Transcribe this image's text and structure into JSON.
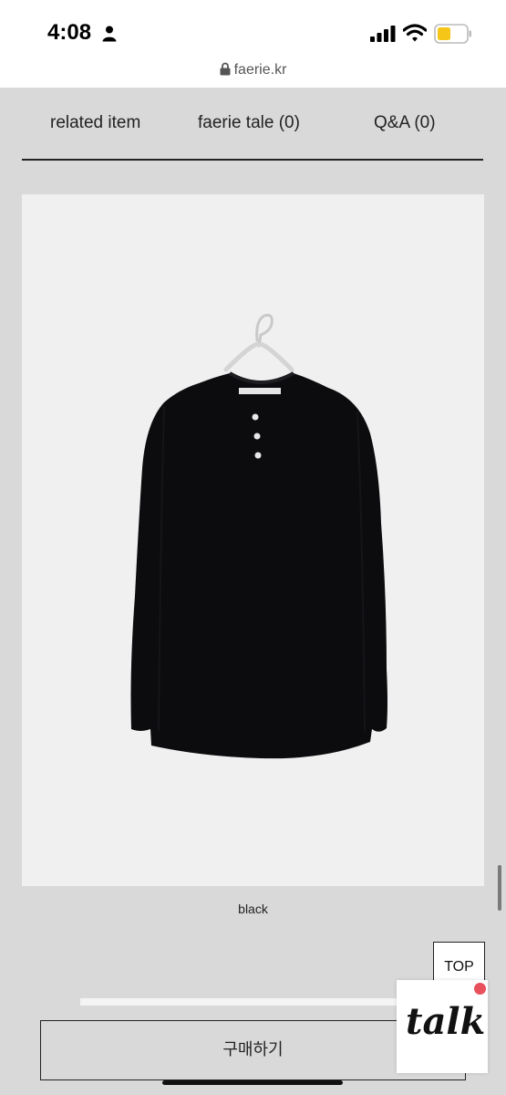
{
  "status_bar": {
    "time": "4:08",
    "icons": [
      "person-icon",
      "signal-icon",
      "wifi-icon",
      "battery-icon"
    ],
    "battery_color": "#f5c518"
  },
  "url_bar": {
    "url": "faerie.kr",
    "icon": "lock-icon"
  },
  "tabs": [
    {
      "label": "related item"
    },
    {
      "label": "faerie tale (0)"
    },
    {
      "label": "Q&A (0)"
    }
  ],
  "product": {
    "image_icon": "shirt-on-hanger",
    "caption": "black",
    "garment_color": "#0c0c0f",
    "background_color": "#f0f0f0"
  },
  "top_button": {
    "label": "TOP"
  },
  "bottom_bar": {
    "buy_label": "구매하기"
  },
  "talk_widget": {
    "label": "talk",
    "dot_color": "#e8505b"
  }
}
